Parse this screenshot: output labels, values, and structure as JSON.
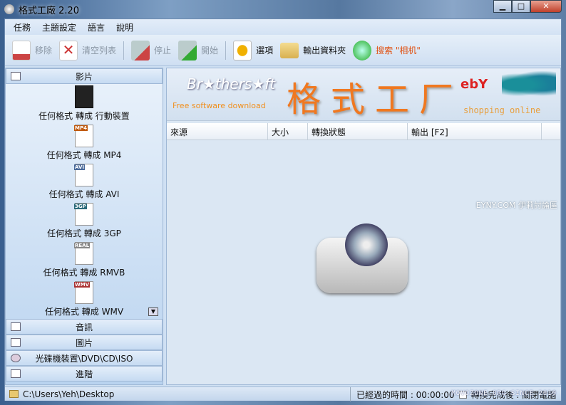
{
  "window": {
    "title": "格式工廠 2.20"
  },
  "menu": [
    "任務",
    "主題設定",
    "語言",
    "說明"
  ],
  "toolbar": {
    "remove": "移除",
    "clear": "清空列表",
    "stop": "停止",
    "start": "開始",
    "options": "選項",
    "output_folder": "輸出資料夾",
    "search": "搜索 \"相机\""
  },
  "sidebar": {
    "video": "影片",
    "items": [
      "任何格式 轉成 行動裝置",
      "任何格式 轉成 MP4",
      "任何格式 轉成 AVI",
      "任何格式 轉成 3GP",
      "任何格式 轉成 RMVB",
      "任何格式 轉成 WMV"
    ],
    "badges": [
      "",
      "MP4",
      "AVI",
      "3GP",
      "REAL",
      "WMV"
    ],
    "audio": "音訊",
    "picture": "圖片",
    "rom": "光碟機裝置\\DVD\\CD\\ISO",
    "advanced": "進階"
  },
  "banner": {
    "brothersoft": "Br★thers★ft",
    "free": "Free software download",
    "title": "格式工厂",
    "ebay": "ebY",
    "shopping": "shopping online"
  },
  "table": {
    "columns": [
      "來源",
      "大小",
      "轉換狀態",
      "輸出 [F2]"
    ]
  },
  "watermark": "EYNY.COM 伊莉討論區",
  "status": {
    "path": "C:\\Users\\Yeh\\Desktop",
    "elapsed": "已經過的時間 : 00:00:00",
    "after": "轉換完成後 : 關閉電腦",
    "watermark": "MOVOZONE.ORG SINCE 2010"
  }
}
